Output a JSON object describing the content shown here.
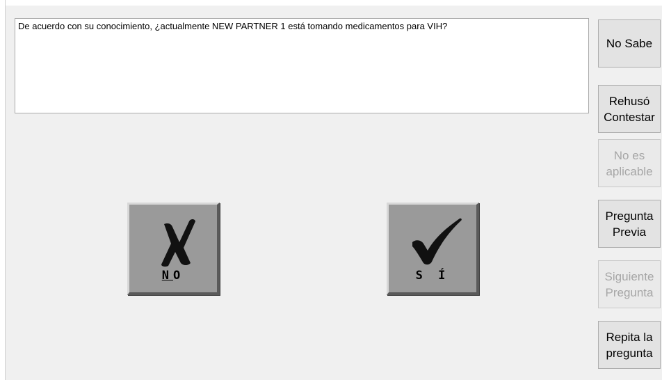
{
  "question": {
    "text": "De acuerdo con su conocimiento, ¿actualmente NEW PARTNER 1 está tomando medicamentos para VIH?"
  },
  "answers": {
    "no": {
      "label_first": "N",
      "label_rest": "O",
      "icon": "x-mark-icon"
    },
    "yes": {
      "label": "S Í",
      "icon": "checkmark-icon"
    }
  },
  "side_buttons": [
    {
      "label": "No Sabe",
      "enabled": true
    },
    {
      "label": "Rehusó\nContestar",
      "enabled": true
    },
    {
      "label": "No es\naplicable",
      "enabled": false
    },
    {
      "label": "Pregunta\nPrevia",
      "enabled": true
    },
    {
      "label": "Siguiente\nPregunta",
      "enabled": false
    },
    {
      "label": "Repita la\npregunta",
      "enabled": true
    }
  ]
}
